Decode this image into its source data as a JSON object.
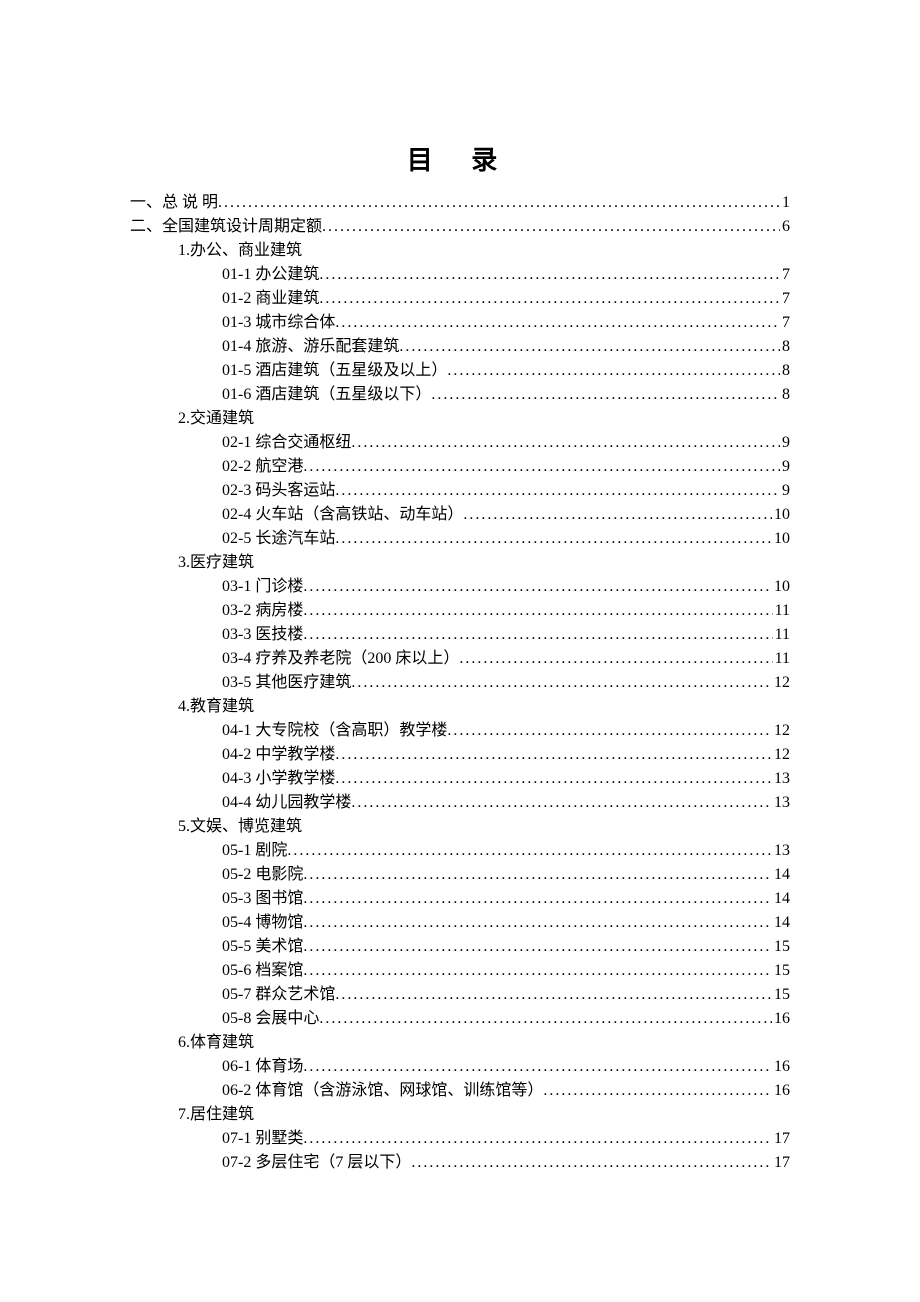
{
  "title": "目 录",
  "entries": [
    {
      "level": 0,
      "label": "一、总 说 明",
      "page": "1"
    },
    {
      "level": 0,
      "label": "二、全国建筑设计周期定额",
      "page": "6"
    },
    {
      "level": 1,
      "label": "1.办公、商业建筑",
      "page": null
    },
    {
      "level": 2,
      "label": "01-1 办公建筑",
      "page": "7"
    },
    {
      "level": 2,
      "label": "01-2 商业建筑",
      "page": "7"
    },
    {
      "level": 2,
      "label": "01-3 城市综合体",
      "page": "7"
    },
    {
      "level": 2,
      "label": "01-4 旅游、游乐配套建筑",
      "page": "8"
    },
    {
      "level": 2,
      "label": "01-5 酒店建筑（五星级及以上）",
      "page": "8"
    },
    {
      "level": 2,
      "label": "01-6 酒店建筑（五星级以下）",
      "page": "8"
    },
    {
      "level": 1,
      "label": "2.交通建筑",
      "page": null
    },
    {
      "level": 2,
      "label": "02-1 综合交通枢纽",
      "page": "9"
    },
    {
      "level": 2,
      "label": "02-2 航空港",
      "page": "9"
    },
    {
      "level": 2,
      "label": "02-3 码头客运站",
      "page": "9"
    },
    {
      "level": 2,
      "label": "02-4 火车站（含高铁站、动车站）",
      "page": "10"
    },
    {
      "level": 2,
      "label": "02-5 长途汽车站",
      "page": "10"
    },
    {
      "level": 1,
      "label": "3.医疗建筑",
      "page": null
    },
    {
      "level": 2,
      "label": "03-1 门诊楼",
      "page": "10"
    },
    {
      "level": 2,
      "label": "03-2 病房楼",
      "page": "11"
    },
    {
      "level": 2,
      "label": "03-3 医技楼",
      "page": "11"
    },
    {
      "level": 2,
      "label": "03-4 疗养及养老院（200 床以上）",
      "page": "11"
    },
    {
      "level": 2,
      "label": "03-5 其他医疗建筑",
      "page": "12"
    },
    {
      "level": 1,
      "label": "4.教育建筑",
      "page": null
    },
    {
      "level": 2,
      "label": "04-1 大专院校（含高职）教学楼",
      "page": "12"
    },
    {
      "level": 2,
      "label": "04-2 中学教学楼",
      "page": "12"
    },
    {
      "level": 2,
      "label": "04-3 小学教学楼",
      "page": "13"
    },
    {
      "level": 2,
      "label": "04-4 幼儿园教学楼",
      "page": "13"
    },
    {
      "level": 1,
      "label": "5.文娱、博览建筑",
      "page": null
    },
    {
      "level": 2,
      "label": "05-1 剧院",
      "page": "13"
    },
    {
      "level": 2,
      "label": "05-2 电影院",
      "page": "14"
    },
    {
      "level": 2,
      "label": "05-3 图书馆",
      "page": "14"
    },
    {
      "level": 2,
      "label": "05-4 博物馆",
      "page": "14"
    },
    {
      "level": 2,
      "label": "05-5 美术馆",
      "page": "15"
    },
    {
      "level": 2,
      "label": "05-6 档案馆",
      "page": "15"
    },
    {
      "level": 2,
      "label": "05-7 群众艺术馆",
      "page": "15"
    },
    {
      "level": 2,
      "label": "05-8 会展中心",
      "page": "16"
    },
    {
      "level": 1,
      "label": "6.体育建筑",
      "page": null
    },
    {
      "level": 2,
      "label": "06-1 体育场",
      "page": "16"
    },
    {
      "level": 2,
      "label": "06-2 体育馆（含游泳馆、网球馆、训练馆等）",
      "page": "16"
    },
    {
      "level": 1,
      "label": "7.居住建筑",
      "page": null
    },
    {
      "level": 2,
      "label": "07-1 别墅类",
      "page": "17"
    },
    {
      "level": 2,
      "label": "07-2 多层住宅（7 层以下）",
      "page": "17"
    }
  ]
}
